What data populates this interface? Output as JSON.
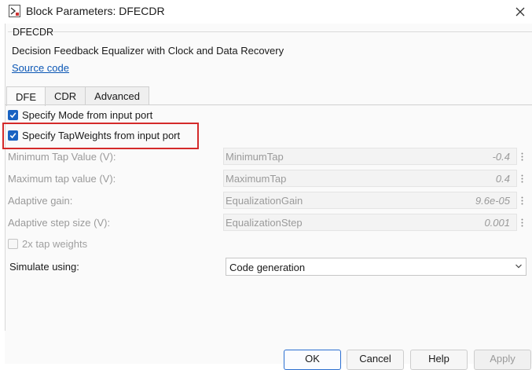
{
  "window": {
    "title": "Block Parameters: DFECDR",
    "icons": {
      "app": "block-params-icon",
      "close": "close-icon"
    }
  },
  "block": {
    "name": "DFECDR",
    "description": "Decision Feedback Equalizer with Clock and Data Recovery",
    "source_link": "Source code"
  },
  "tabs": [
    {
      "label": "DFE",
      "active": true
    },
    {
      "label": "CDR",
      "active": false
    },
    {
      "label": "Advanced",
      "active": false
    }
  ],
  "checkboxes": {
    "mode_from_port": {
      "label": "Specify Mode from input port",
      "checked": true,
      "enabled": true
    },
    "tapweights_from_port": {
      "label": "Specify TapWeights from input port",
      "checked": true,
      "enabled": true,
      "highlighted": true
    },
    "two_x_tap": {
      "label": "2x tap weights",
      "checked": false,
      "enabled": false
    }
  },
  "params": [
    {
      "label": "Minimum Tap Value (V):",
      "name": "MinimumTap",
      "value": "-0.4"
    },
    {
      "label": "Maximum tap value (V):",
      "name": "MaximumTap",
      "value": "0.4"
    },
    {
      "label": "Adaptive gain:",
      "name": "EqualizationGain",
      "value": "9.6e-05"
    },
    {
      "label": "Adaptive step size (V):",
      "name": "EqualizationStep",
      "value": "0.001"
    }
  ],
  "simulate": {
    "label": "Simulate using:",
    "value": "Code generation"
  },
  "buttons": {
    "ok": "OK",
    "cancel": "Cancel",
    "help": "Help",
    "apply": "Apply"
  },
  "colors": {
    "accent": "#1a63c2",
    "highlight": "#d42a2a",
    "link": "#0b57b5"
  }
}
